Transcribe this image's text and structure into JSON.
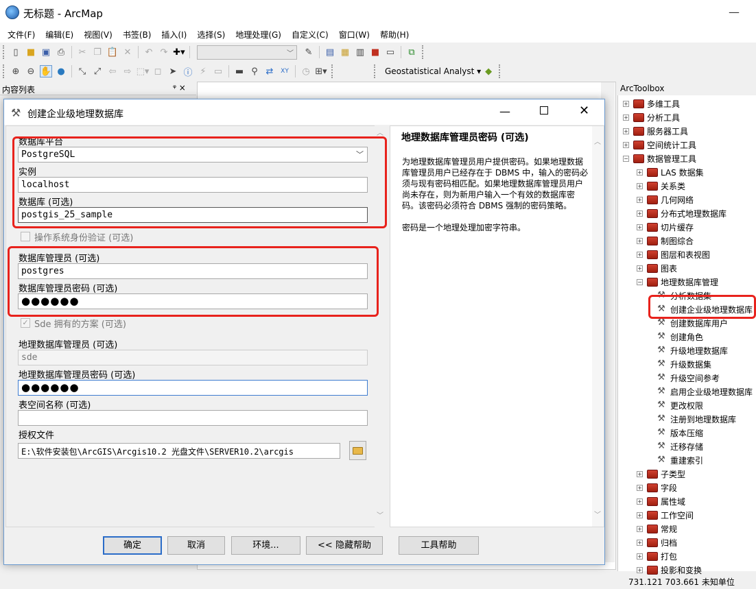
{
  "app": {
    "title": "无标题 - ArcMap",
    "minimize_glyph": "—"
  },
  "menu": [
    "文件(F)",
    "编辑(E)",
    "视图(V)",
    "书签(B)",
    "插入(I)",
    "选择(S)",
    "地理处理(G)",
    "自定义(C)",
    "窗口(W)",
    "帮助(H)"
  ],
  "toolbar2": {
    "geostat_label": "Geostatistical Analyst ▾"
  },
  "toc": {
    "title": "内容列表",
    "pin": "ᵠ ×"
  },
  "arctoolbox": {
    "title": "ArcToolbox",
    "top_items": [
      {
        "label": "多维工具",
        "state": "+"
      },
      {
        "label": "分析工具",
        "state": "+"
      },
      {
        "label": "服务器工具",
        "state": "+"
      },
      {
        "label": "空间统计工具",
        "state": "+"
      },
      {
        "label": "数据管理工具",
        "state": "−"
      }
    ],
    "dm_items": [
      {
        "label": "LAS 数据集",
        "state": "+"
      },
      {
        "label": "关系类",
        "state": "+"
      },
      {
        "label": "几何网络",
        "state": "+"
      },
      {
        "label": "分布式地理数据库",
        "state": "+"
      },
      {
        "label": "切片缓存",
        "state": "+"
      },
      {
        "label": "制图综合",
        "state": "+"
      },
      {
        "label": "图层和表视图",
        "state": "+"
      },
      {
        "label": "图表",
        "state": "+"
      },
      {
        "label": "地理数据库管理",
        "state": "−"
      }
    ],
    "gdb_tools": [
      "分析数据集",
      "创建企业级地理数据库",
      "创建数据库用户",
      "创建角色",
      "升级地理数据库",
      "升级数据集",
      "升级空间参考",
      "启用企业级地理数据库",
      "更改权限",
      "注册到地理数据库",
      "版本压缩",
      "迁移存储",
      "重建索引"
    ],
    "after_items": [
      {
        "label": "子类型",
        "state": "+"
      },
      {
        "label": "字段",
        "state": "+"
      },
      {
        "label": "属性域",
        "state": "+"
      },
      {
        "label": "工作空间",
        "state": "+"
      },
      {
        "label": "常规",
        "state": "+"
      },
      {
        "label": "归档",
        "state": "+"
      },
      {
        "label": "打包",
        "state": "+"
      },
      {
        "label": "投影和变换",
        "state": "+"
      }
    ]
  },
  "status": {
    "coords": "731.121  703.661 未知单位"
  },
  "dialog": {
    "title": "创建企业级地理数据库",
    "fields": {
      "db_platform_label": "数据库平台",
      "db_platform_value": "PostgreSQL",
      "instance_label": "实例",
      "instance_value": "localhost",
      "database_label": "数据库 (可选)",
      "database_value": "postgis_25_sample",
      "os_auth_label": "操作系统身份验证 (可选)",
      "db_admin_label": "数据库管理员 (可选)",
      "db_admin_value": "postgres",
      "db_admin_pw_label": "数据库管理员密码 (可选)",
      "db_admin_pw_value": "●●●●●●",
      "sde_schema_label": "Sde 拥有的方案 (可选)",
      "gdb_admin_label": "地理数据库管理员 (可选)",
      "gdb_admin_value": "sde",
      "gdb_admin_pw_label": "地理数据库管理员密码 (可选)",
      "gdb_admin_pw_value": "●●●●●●",
      "tablespace_label": "表空间名称 (可选)",
      "tablespace_value": "",
      "auth_file_label": "授权文件",
      "auth_file_value": "E:\\软件安装包\\ArcGIS\\Arcgis10.2 光盘文件\\SERVER10.2\\arcgis"
    },
    "help": {
      "title": "地理数据库管理员密码 (可选)",
      "para1": "为地理数据库管理员用户提供密码。如果地理数据库管理员用户已经存在于 DBMS 中，输入的密码必须与现有密码相匹配。如果地理数据库管理员用户尚未存在，则为新用户输入一个有效的数据库密码。该密码必须符合 DBMS 强制的密码策略。",
      "para2": "密码是一个地理处理加密字符串。"
    },
    "buttons": {
      "ok": "确定",
      "cancel": "取消",
      "env": "环境...",
      "hide_help": "<< 隐藏帮助",
      "tool_help": "工具帮助"
    }
  }
}
